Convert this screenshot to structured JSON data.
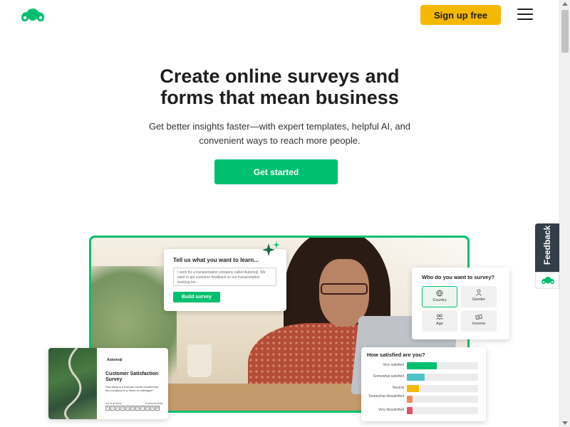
{
  "header": {
    "logo_icon": "surveymonkey-logo-icon",
    "signup_label": "Sign up free",
    "menu_icon": "hamburger-menu-icon"
  },
  "hero": {
    "title_line1": "Create online surveys and",
    "title_line2": "forms that mean business",
    "subtitle_line1": "Get better insights faster—with expert templates, helpful AI, and",
    "subtitle_line2": "convenient ways to reach more people.",
    "cta_label": "Get started"
  },
  "tell_card": {
    "title": "Tell us what you want to learn...",
    "placeholder": "I work for a transportation company called Automoji. We want to get customer feedback on our transportation booking exi...",
    "button_label": "Build survey"
  },
  "who_card": {
    "title": "Who do you want to survey?",
    "options": [
      {
        "label": "Country",
        "icon": "globe-icon",
        "selected": true
      },
      {
        "label": "Gender",
        "icon": "person-icon",
        "selected": false
      },
      {
        "label": "Age",
        "icon": "group-icon",
        "selected": false
      },
      {
        "label": "Income",
        "icon": "money-icon",
        "selected": false
      }
    ]
  },
  "satisfaction_card": {
    "title": "How satisfied are you?",
    "rows": [
      {
        "label": "Very satisfied",
        "value": 0.42,
        "color": "#00bf6f"
      },
      {
        "label": "Somewhat satisfied",
        "value": 0.25,
        "color": "#4fc3c7"
      },
      {
        "label": "Neutral",
        "value": 0.17,
        "color": "#f5b800"
      },
      {
        "label": "Somewhat dissatisfied",
        "value": 0.08,
        "color": "#f08a5d"
      },
      {
        "label": "Very dissatisfied",
        "value": 0.08,
        "color": "#e0506a"
      }
    ]
  },
  "customer_card": {
    "brand": "Automoji",
    "title": "Customer Satisfaction Survey",
    "question": "How likely is it that you would recommend this company to a friend or colleague?",
    "low_label": "Not at all likely",
    "high_label": "Extremely likely",
    "scale": [
      "0",
      "1",
      "2",
      "3",
      "4",
      "5",
      "6",
      "7",
      "8",
      "9",
      "10"
    ]
  },
  "feedback": {
    "label": "Feedback",
    "icon": "surveymonkey-logo-icon"
  },
  "colors": {
    "brand_green": "#00bf6f",
    "signup_yellow": "#f5b800",
    "feedback_dark": "#333e48"
  }
}
